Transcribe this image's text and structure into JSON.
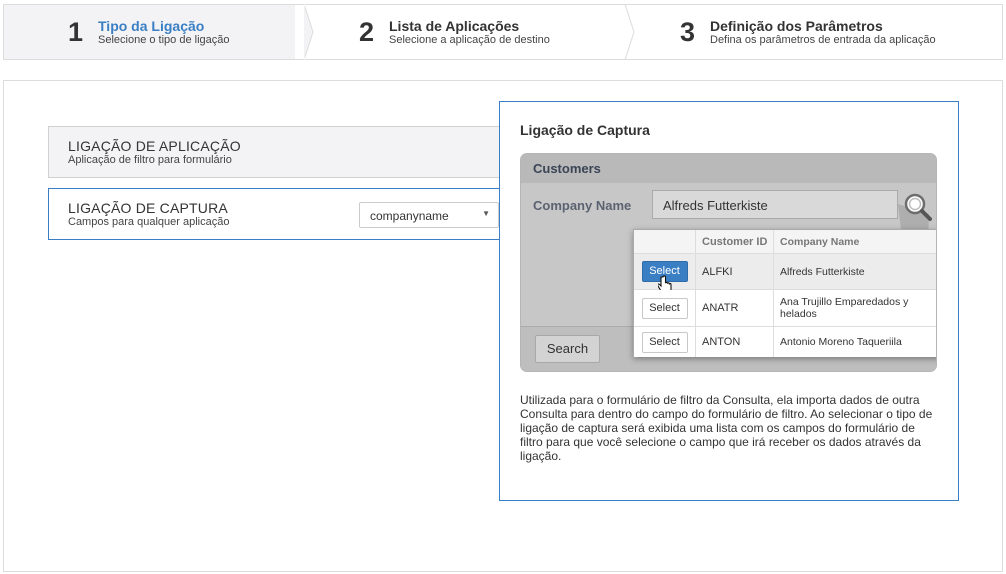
{
  "wizard": {
    "steps": [
      {
        "number": "1",
        "title": "Tipo da Ligação",
        "subtitle": "Selecione o tipo de ligação",
        "active": true
      },
      {
        "number": "2",
        "title": "Lista de Aplicações",
        "subtitle": "Selecione a aplicação de destino",
        "active": false
      },
      {
        "number": "3",
        "title": "Definição dos Parâmetros",
        "subtitle": "Defina os parâmetros de entrada da aplicação",
        "active": false
      }
    ]
  },
  "options": [
    {
      "title": "LIGAÇÃO DE APLICAÇÃO",
      "subtitle": "Aplicação de filtro para formulário"
    },
    {
      "title": "LIGAÇÃO DE CAPTURA",
      "subtitle": "Campos para qualquer aplicação"
    }
  ],
  "field_select": {
    "value": "companyname"
  },
  "detail": {
    "title": "Ligação de Captura",
    "description": "Utilizada para o formulário de filtro da Consulta, ela importa dados de outra Consulta para dentro do campo do formulário de filtro. Ao selecionar o tipo de ligação de captura será exibida uma lista com os campos do formulário de filtro para que você selecione o campo que irá receber os dados através da ligação."
  },
  "illustration": {
    "header": "Customers",
    "field_label": "Company Name",
    "field_value": "Alfreds Futterkiste",
    "search_label": "Search",
    "columns": [
      "Customer ID",
      "Company Name"
    ],
    "rows": [
      {
        "button": "Select",
        "id": "ALFKI",
        "name": "Alfreds Futterkiste"
      },
      {
        "button": "Select",
        "id": "ANATR",
        "name": "Ana Trujillo Emparedados y helados"
      },
      {
        "button": "Select",
        "id": "ANTON",
        "name": "Antonio Moreno Taqueriila"
      }
    ]
  },
  "colors": {
    "accent": "#3a7fc4",
    "active_step_bg": "#f3f3f5"
  },
  "icons": {
    "magnifier": "search-icon",
    "cursor": "hand-pointer-icon",
    "select_caret": "caret-down-icon"
  }
}
